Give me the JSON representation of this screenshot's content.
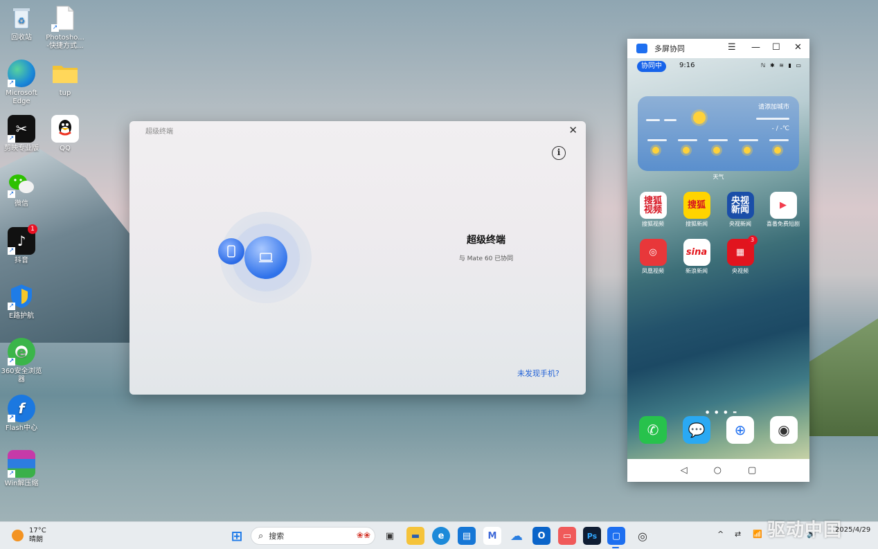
{
  "desktop_icons": [
    {
      "label": "回收站",
      "icon": "recycle-bin-icon"
    },
    {
      "label": "Photosho...\n-快捷方式...",
      "icon": "document-icon"
    },
    {
      "label": "Microsoft\nEdge",
      "icon": "edge-icon"
    },
    {
      "label": "tup",
      "icon": "folder-icon"
    },
    {
      "label": "剪映专业版",
      "icon": "capcut-icon"
    },
    {
      "label": "QQ",
      "icon": "qq-icon"
    },
    {
      "label": "微信",
      "icon": "wechat-icon"
    },
    {
      "label": "抖音",
      "icon": "douyin-icon",
      "badge": "1"
    },
    {
      "label": "E路护航",
      "icon": "shield-icon"
    },
    {
      "label": "360安全浏览\n器",
      "icon": "browser-360-icon"
    },
    {
      "label": "Flash中心",
      "icon": "flash-icon"
    },
    {
      "label": "Win解压缩",
      "icon": "archive-icon"
    }
  ],
  "dialog": {
    "title": "超级终端",
    "heading": "超级终端",
    "subtitle": "与 Mate 60 已协同",
    "link": "未发现手机?",
    "close": "✕",
    "info": "i"
  },
  "phone_window": {
    "title": "多屏协同",
    "controls": [
      "☰",
      "—",
      "☐",
      "✕"
    ],
    "status": {
      "collab": "协同中",
      "time": "9:16"
    },
    "weather": {
      "city": "请添加城市",
      "temp": "- / -℃",
      "label": "天气"
    },
    "apps": [
      {
        "name": "搜狐视频",
        "glyph": "搜狐\n视频",
        "bg": "#ffffff",
        "fg": "#d6121f"
      },
      {
        "name": "搜狐新闻",
        "glyph": "搜狐",
        "bg": "#ffd400",
        "fg": "#d6121f"
      },
      {
        "name": "央视新闻",
        "glyph": "央视\n新闻",
        "bg": "#1a4ea8",
        "fg": "#ffffff"
      },
      {
        "name": "喜番免费短剧",
        "glyph": "▶",
        "bg": "#ffffff",
        "fg": "#f23d4d"
      },
      {
        "name": "凤凰视频",
        "glyph": "◎",
        "bg": "#e8373a",
        "fg": "#ffffff"
      },
      {
        "name": "新浪新闻",
        "glyph": "sina",
        "bg": "#ffffff",
        "fg": "#e4141b"
      },
      {
        "name": "央视频",
        "glyph": "▦",
        "bg": "#e1141e",
        "fg": "#ffffff",
        "badge": "3"
      }
    ],
    "dock": [
      {
        "name": "phone",
        "glyph": "✆",
        "bg": "#27c24c"
      },
      {
        "name": "messages",
        "glyph": "💬",
        "bg": "#2aa9f3"
      },
      {
        "name": "browser",
        "glyph": "⊕",
        "bg": "#ffffff"
      },
      {
        "name": "camera",
        "glyph": "◉",
        "bg": "#ffffff"
      }
    ],
    "nav": [
      "◁",
      "○",
      "▢"
    ]
  },
  "taskbar": {
    "weather_temp": "17°C",
    "weather_desc": "晴朗",
    "search_placeholder": "搜索",
    "apps": [
      {
        "name": "start",
        "glyph": "⊞",
        "bg": "#1e7ae8"
      },
      {
        "name": "task-view",
        "glyph": "▣",
        "bg": "#333333"
      },
      {
        "name": "file-explorer",
        "glyph": "▬",
        "bg": "#f5c33a"
      },
      {
        "name": "edge",
        "glyph": "e",
        "bg": "#1d8ad9"
      },
      {
        "name": "store",
        "glyph": "▤",
        "bg": "#1677d6"
      },
      {
        "name": "app-m",
        "glyph": "M",
        "bg": "#3f6ad8"
      },
      {
        "name": "onedrive",
        "glyph": "☁",
        "bg": "#2a7ee0"
      },
      {
        "name": "outlook",
        "glyph": "O",
        "bg": "#0a64c9"
      },
      {
        "name": "gift",
        "glyph": "▭",
        "bg": "#f05a5a"
      },
      {
        "name": "photoshop",
        "glyph": "Ps",
        "bg": "#0f1d33"
      },
      {
        "name": "multiscreen",
        "glyph": "▢",
        "bg": "#1e6ff0"
      },
      {
        "name": "recorder",
        "glyph": "◎",
        "bg": "#444444"
      }
    ],
    "tray": [
      "^",
      "⇄",
      "📶",
      "🔊"
    ],
    "date": "2025/4/29",
    "watermark": "驱动中国"
  }
}
